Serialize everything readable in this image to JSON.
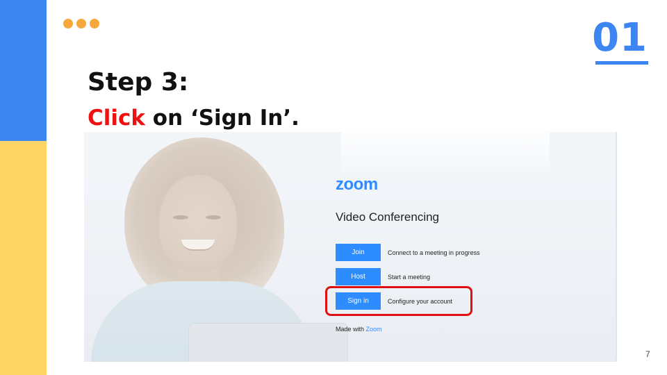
{
  "colors": {
    "primary_blue": "#3d85f0",
    "yellow": "#ffd666",
    "dot_orange": "#f7a83a",
    "accent_red": "#ee1111",
    "zoom_blue": "#2d8cff"
  },
  "header": {
    "slide_number": "01"
  },
  "step": {
    "title": "Step 3:",
    "instruction_accent": "Click",
    "instruction_rest": " on ‘Sign In’."
  },
  "zoom_screen": {
    "logo": "zoom",
    "heading": "Video Conferencing",
    "rows": [
      {
        "button": "Join",
        "description": "Connect to a meeting in progress"
      },
      {
        "button": "Host",
        "description": "Start a meeting"
      },
      {
        "button": "Sign in",
        "description": "Configure your account"
      }
    ],
    "footer_prefix": "Made with ",
    "footer_brand": "Zoom"
  },
  "footer": {
    "page_number": "7"
  }
}
